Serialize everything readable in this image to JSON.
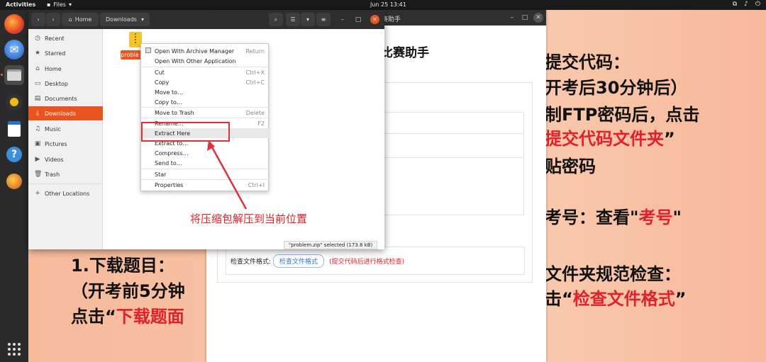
{
  "topbar": {
    "activities": "Activities",
    "app_name": "Files",
    "clock": "Jun 25  13:41",
    "tray_icons": [
      "network-icon",
      "volume-icon",
      "power-icon"
    ]
  },
  "dock": {
    "items": [
      "firefox-icon",
      "thunderbird-icon",
      "files-icon",
      "rhythmbox-icon",
      "writer-icon",
      "help-icon",
      "app-icon"
    ]
  },
  "files_window": {
    "home_label": "Home",
    "path_label": "Downloads",
    "sidebar": [
      {
        "label": "Recent",
        "icon": "clock-icon"
      },
      {
        "label": "Starred",
        "icon": "star-icon"
      },
      {
        "label": "Home",
        "icon": "home-icon"
      },
      {
        "label": "Desktop",
        "icon": "desktop-icon"
      },
      {
        "label": "Documents",
        "icon": "document-icon"
      },
      {
        "label": "Downloads",
        "icon": "download-icon"
      },
      {
        "label": "Music",
        "icon": "music-icon"
      },
      {
        "label": "Pictures",
        "icon": "picture-icon"
      },
      {
        "label": "Videos",
        "icon": "video-icon"
      },
      {
        "label": "Trash",
        "icon": "trash-icon"
      },
      {
        "label": "Other Locations",
        "icon": "plus-icon"
      }
    ],
    "selected_file_label": "proble zip",
    "status": "\"problem.zip\" selected  (173.8 kB)"
  },
  "context_menu": {
    "items": [
      {
        "label": "Open With Archive Manager",
        "shortcut": "Return"
      },
      {
        "label": "Open With Other Application",
        "shortcut": ""
      },
      {
        "label": "Cut",
        "shortcut": "Ctrl+X"
      },
      {
        "label": "Copy",
        "shortcut": "Ctrl+C"
      },
      {
        "label": "Move to…",
        "shortcut": ""
      },
      {
        "label": "Copy to…",
        "shortcut": ""
      },
      {
        "label": "Move to Trash",
        "shortcut": "Delete"
      },
      {
        "label": "Rename…",
        "shortcut": "F2"
      },
      {
        "label": "Extract Here",
        "shortcut": ""
      },
      {
        "label": "Extract to…",
        "shortcut": ""
      },
      {
        "label": "Compress…",
        "shortcut": ""
      },
      {
        "label": "Send to…",
        "shortcut": ""
      },
      {
        "label": "Star",
        "shortcut": ""
      },
      {
        "label": "Properties",
        "shortcut": "Ctrl+I"
      }
    ]
  },
  "annotation": {
    "text": "将压缩包解压到当前位置",
    "color": "#e0202a"
  },
  "assistant_window": {
    "title": "赛助手",
    "heading": "比赛助手",
    "check_label": "检查文件格式:",
    "check_button": "检查文件格式",
    "check_hint": "(提交代码后进行格式检查)"
  },
  "slide": {
    "right_lines": [
      {
        "text": "提交代码：",
        "red": ""
      },
      {
        "text": "开考后30分钟后）",
        "red": ""
      },
      {
        "text": "制FTP密码后，点击",
        "red": ""
      },
      {
        "text": "",
        "red": "提交代码文件夹",
        "tail": "”"
      },
      {
        "text": "贴密码",
        "red": ""
      },
      {
        "text": "考号：查看\"",
        "red": "考号",
        "tail": "\""
      },
      {
        "text": "文件夹规范检查：",
        "red": ""
      },
      {
        "text": "击“",
        "red": "检查文件格式",
        "tail": "”"
      }
    ],
    "left_lines": [
      {
        "text": "1.下载题目：",
        "red": ""
      },
      {
        "text": "（开考前5分钟",
        "red": ""
      },
      {
        "text": "点击“",
        "red": "下载题面"
      }
    ]
  }
}
